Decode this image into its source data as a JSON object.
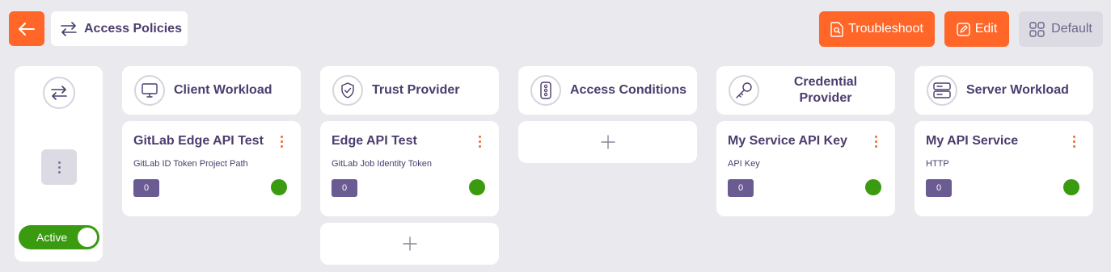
{
  "header": {
    "title": "Access Policies",
    "troubleshoot_label": "Troubleshoot",
    "edit_label": "Edit",
    "default_label": "Default"
  },
  "policy": {
    "toggle_label": "Active"
  },
  "columns": [
    {
      "label": "Client Workload",
      "icon": "monitor-icon"
    },
    {
      "label": "Trust Provider",
      "icon": "shield-check-icon"
    },
    {
      "label": "Access Conditions",
      "icon": "traffic-light-icon"
    },
    {
      "label": "Credential Provider",
      "icon": "key-icon"
    },
    {
      "label": "Server Workload",
      "icon": "server-icon"
    }
  ],
  "cards": {
    "client": {
      "title": "GitLab Edge API Test",
      "subtitle": "GitLab ID Token Project Path",
      "count": "0"
    },
    "trust": {
      "title": "Edge API Test",
      "subtitle": "GitLab Job Identity Token",
      "count": "0"
    },
    "credential": {
      "title": "My Service API Key",
      "subtitle": "API Key",
      "count": "0"
    },
    "server": {
      "title": "My API Service",
      "subtitle": "HTTP",
      "count": "0"
    }
  },
  "colors": {
    "accent": "#ff6628",
    "status_ok": "#3a9b10",
    "badge": "#6b5b93",
    "text": "#4b3d6e"
  }
}
